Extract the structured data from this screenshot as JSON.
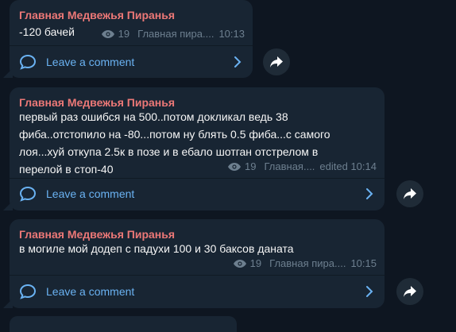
{
  "messages": [
    {
      "sender": "Главная Медвежья Пиранья",
      "text": "-120 бачей",
      "views": "19",
      "signature": "Главная пира....",
      "time": "10:13",
      "comment_label": "Leave a comment"
    },
    {
      "sender": "Главная Медвежья Пиранья",
      "text": "первый раз ошибся на 500..потом докликал ведь 38\nфиба..отстопило на -80...потом ну блять 0.5 фиба...с самого\nлоя...хуй откупа 2.5к в позе и в ебало шотган отстрелом в\nперелой в стоп-40",
      "views": "19",
      "signature": "Главная....",
      "time": "edited 10:14",
      "comment_label": "Leave a comment"
    },
    {
      "sender": "Главная Медвежья Пиранья",
      "text": "в могиле мой додеп с падухи 100 и 30 баксов даната",
      "views": "19",
      "signature": "Главная пира....",
      "time": "10:15",
      "comment_label": "Leave a comment"
    }
  ],
  "icons": {
    "views": "eye-icon",
    "comment": "comment-bubble-icon",
    "chevron": "chevron-right-icon",
    "share": "share-arrow-icon"
  },
  "colors": {
    "background": "#0e1621",
    "bubble": "#182533",
    "sender": "#ec7877",
    "link": "#6ab2f2",
    "meta": "#6d7f8f"
  }
}
